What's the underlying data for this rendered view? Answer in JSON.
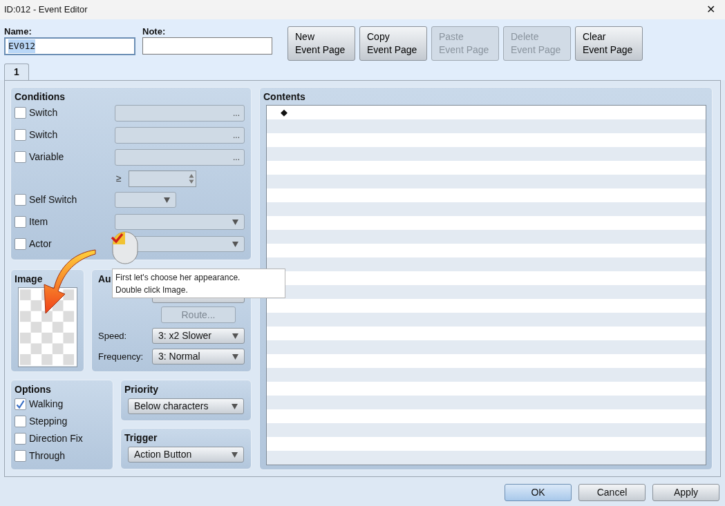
{
  "window": {
    "title": "ID:012 - Event Editor",
    "close": "✕"
  },
  "name": {
    "label": "Name:",
    "value": "EV012"
  },
  "note": {
    "label": "Note:"
  },
  "page_buttons": [
    {
      "lines": [
        "New",
        "Event Page"
      ],
      "disabled": false
    },
    {
      "lines": [
        "Copy",
        "Event Page"
      ],
      "disabled": false
    },
    {
      "lines": [
        "Paste",
        "Event Page"
      ],
      "disabled": true
    },
    {
      "lines": [
        "Delete",
        "Event Page"
      ],
      "disabled": true
    },
    {
      "lines": [
        "Clear",
        "Event Page"
      ],
      "disabled": false
    }
  ],
  "tabs": [
    {
      "label": "1",
      "selected": true
    }
  ],
  "conditions": {
    "title": "Conditions",
    "rows": [
      {
        "kind": "picker",
        "label": "Switch",
        "checked": false,
        "button": "..."
      },
      {
        "kind": "picker",
        "label": "Switch",
        "checked": false,
        "button": "..."
      },
      {
        "kind": "picker",
        "label": "Variable",
        "checked": false,
        "button": "..."
      },
      {
        "kind": "compare",
        "symbol": "≥"
      },
      {
        "kind": "short_dropdown",
        "label": "Self Switch",
        "checked": false
      },
      {
        "kind": "dropdown",
        "label": "Item",
        "checked": false
      },
      {
        "kind": "dropdown",
        "label": "Actor",
        "checked": false
      }
    ]
  },
  "image": {
    "title": "Image"
  },
  "autonomous": {
    "title": "Au",
    "route": "Route...",
    "speed": {
      "label": "Speed:",
      "value": "3: x2 Slower"
    },
    "frequency": {
      "label": "Frequency:",
      "value": "3: Normal"
    }
  },
  "options": {
    "title": "Options",
    "items": [
      {
        "label": "Walking",
        "checked": true
      },
      {
        "label": "Stepping",
        "checked": false
      },
      {
        "label": "Direction Fix",
        "checked": false
      },
      {
        "label": "Through",
        "checked": false
      }
    ]
  },
  "priority": {
    "title": "Priority",
    "value": "Below characters"
  },
  "trigger": {
    "title": "Trigger",
    "value": "Action Button"
  },
  "contents": {
    "title": "Contents",
    "lines": [
      "◆"
    ]
  },
  "tooltip": {
    "lines": [
      "First let's choose her appearance.",
      "Double click Image."
    ]
  },
  "footer_buttons": [
    {
      "label": "OK",
      "default": true
    },
    {
      "label": "Cancel",
      "default": false
    },
    {
      "label": "Apply",
      "default": false
    }
  ]
}
